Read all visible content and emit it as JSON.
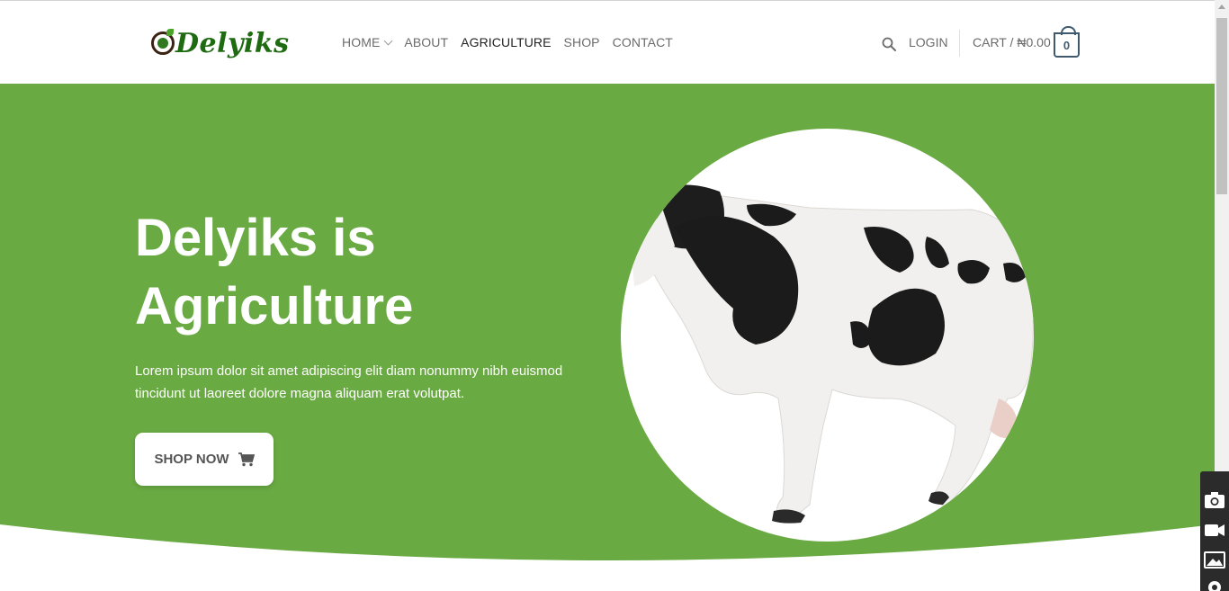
{
  "brand": {
    "name": "Delyiks"
  },
  "nav": {
    "items": [
      {
        "label": "HOME",
        "has_dropdown": true,
        "active": false
      },
      {
        "label": "ABOUT",
        "has_dropdown": false,
        "active": false
      },
      {
        "label": "AGRICULTURE",
        "has_dropdown": false,
        "active": true
      },
      {
        "label": "SHOP",
        "has_dropdown": false,
        "active": false
      },
      {
        "label": "CONTACT",
        "has_dropdown": false,
        "active": false
      }
    ],
    "login_label": "LOGIN",
    "cart_label": "CART /",
    "cart_amount": "₦0.00",
    "cart_count": "0"
  },
  "hero": {
    "title_line1": "Delyiks is",
    "title_line2": "Agriculture",
    "description": "Lorem ipsum dolor sit amet adipiscing elit diam nonummy nibh euismod tincidunt ut laoreet dolore magna aliquam erat volutpat.",
    "cta_label": "SHOP NOW"
  },
  "icons": {
    "search": "search-icon",
    "cart": "cart-icon",
    "camera": "camera-icon",
    "video": "video-icon",
    "image": "image-icon",
    "settings": "gear-icon"
  },
  "colors": {
    "hero_green": "#6aaa43",
    "brand_green": "#1f6b12",
    "nav_text": "#6b6b6b",
    "cart_border": "#3f5a6e"
  }
}
